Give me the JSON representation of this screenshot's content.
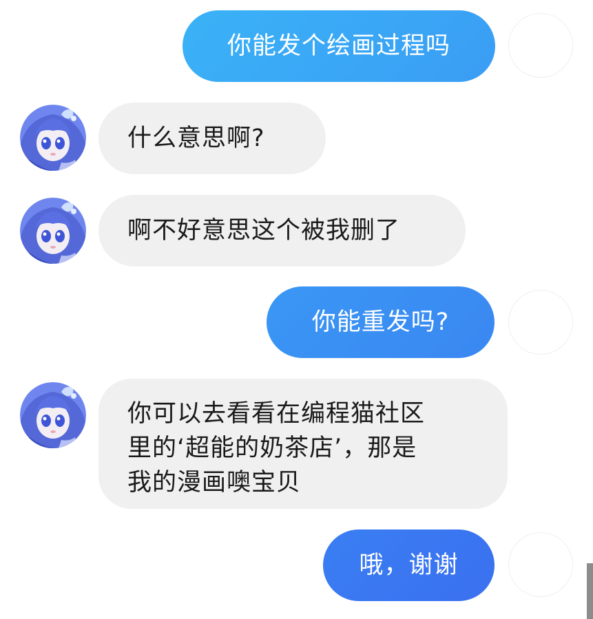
{
  "colors": {
    "outgoing_gradient_light": "#3aa8f6",
    "outgoing_gradient_dark": "#3a77f1",
    "incoming_bg": "#f0f0f0"
  },
  "messages": [
    {
      "sender": "self",
      "text": "你能发个绘画过程吗"
    },
    {
      "sender": "other",
      "text": "什么意思啊?"
    },
    {
      "sender": "other",
      "text": "啊不好意思这个被我删了"
    },
    {
      "sender": "self",
      "text": "你能重发吗?"
    },
    {
      "sender": "other",
      "lines": [
        "你可以去看看在编程猫社区",
        "里的‘超能的奶茶店’，那是",
        "我的漫画噢宝贝"
      ]
    },
    {
      "sender": "self",
      "text": "哦，谢谢"
    }
  ]
}
